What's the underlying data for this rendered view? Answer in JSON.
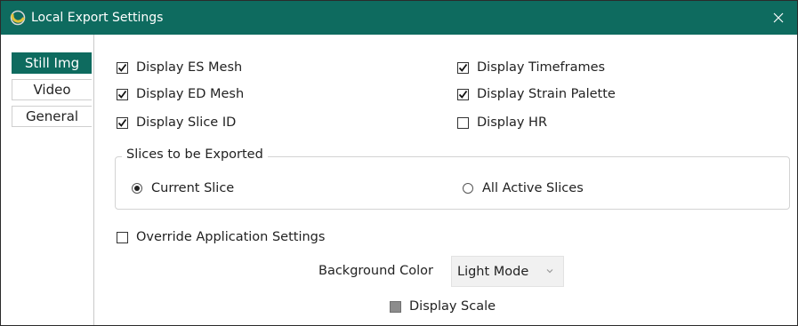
{
  "window": {
    "title": "Local Export Settings",
    "icon": "app-logo-icon",
    "accent": "#0e6b5f"
  },
  "tabs": [
    {
      "label": "Still Img",
      "active": true
    },
    {
      "label": "Video",
      "active": false
    },
    {
      "label": "General",
      "active": false
    }
  ],
  "options": {
    "display_es_mesh": {
      "label": "Display ES Mesh",
      "checked": true
    },
    "display_ed_mesh": {
      "label": "Display ED Mesh",
      "checked": true
    },
    "display_slice_id": {
      "label": "Display Slice ID",
      "checked": true
    },
    "display_timeframes": {
      "label": "Display Timeframes",
      "checked": true
    },
    "display_strain_palette": {
      "label": "Display Strain Palette",
      "checked": true
    },
    "display_hr": {
      "label": "Display HR",
      "checked": false
    }
  },
  "slices_group": {
    "legend": "Slices to be Exported",
    "current_slice": {
      "label": "Current Slice",
      "selected": true
    },
    "all_active_slices": {
      "label": "All Active Slices",
      "selected": false
    }
  },
  "override": {
    "label": "Override Application Settings",
    "checked": false
  },
  "background_color": {
    "label": "Background Color",
    "value": "Light Mode"
  },
  "display_scale": {
    "label": "Display Scale",
    "state": "indeterminate"
  }
}
